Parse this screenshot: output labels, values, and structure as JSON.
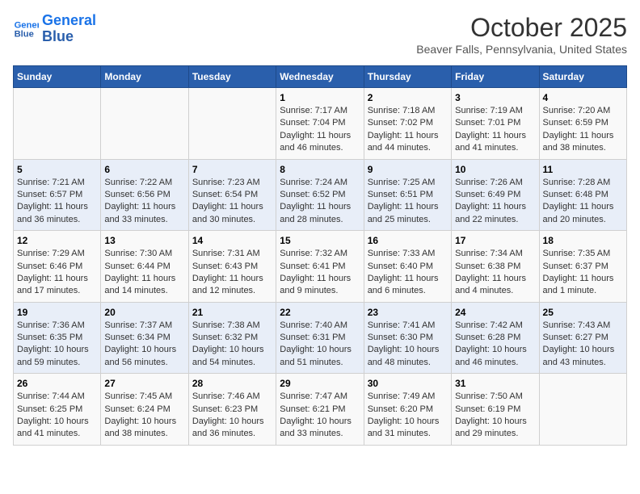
{
  "header": {
    "logo_line1": "General",
    "logo_line2": "Blue",
    "month": "October 2025",
    "location": "Beaver Falls, Pennsylvania, United States"
  },
  "weekdays": [
    "Sunday",
    "Monday",
    "Tuesday",
    "Wednesday",
    "Thursday",
    "Friday",
    "Saturday"
  ],
  "weeks": [
    [
      {
        "day": "",
        "info": ""
      },
      {
        "day": "",
        "info": ""
      },
      {
        "day": "",
        "info": ""
      },
      {
        "day": "1",
        "info": "Sunrise: 7:17 AM\nSunset: 7:04 PM\nDaylight: 11 hours\nand 46 minutes."
      },
      {
        "day": "2",
        "info": "Sunrise: 7:18 AM\nSunset: 7:02 PM\nDaylight: 11 hours\nand 44 minutes."
      },
      {
        "day": "3",
        "info": "Sunrise: 7:19 AM\nSunset: 7:01 PM\nDaylight: 11 hours\nand 41 minutes."
      },
      {
        "day": "4",
        "info": "Sunrise: 7:20 AM\nSunset: 6:59 PM\nDaylight: 11 hours\nand 38 minutes."
      }
    ],
    [
      {
        "day": "5",
        "info": "Sunrise: 7:21 AM\nSunset: 6:57 PM\nDaylight: 11 hours\nand 36 minutes."
      },
      {
        "day": "6",
        "info": "Sunrise: 7:22 AM\nSunset: 6:56 PM\nDaylight: 11 hours\nand 33 minutes."
      },
      {
        "day": "7",
        "info": "Sunrise: 7:23 AM\nSunset: 6:54 PM\nDaylight: 11 hours\nand 30 minutes."
      },
      {
        "day": "8",
        "info": "Sunrise: 7:24 AM\nSunset: 6:52 PM\nDaylight: 11 hours\nand 28 minutes."
      },
      {
        "day": "9",
        "info": "Sunrise: 7:25 AM\nSunset: 6:51 PM\nDaylight: 11 hours\nand 25 minutes."
      },
      {
        "day": "10",
        "info": "Sunrise: 7:26 AM\nSunset: 6:49 PM\nDaylight: 11 hours\nand 22 minutes."
      },
      {
        "day": "11",
        "info": "Sunrise: 7:28 AM\nSunset: 6:48 PM\nDaylight: 11 hours\nand 20 minutes."
      }
    ],
    [
      {
        "day": "12",
        "info": "Sunrise: 7:29 AM\nSunset: 6:46 PM\nDaylight: 11 hours\nand 17 minutes."
      },
      {
        "day": "13",
        "info": "Sunrise: 7:30 AM\nSunset: 6:44 PM\nDaylight: 11 hours\nand 14 minutes."
      },
      {
        "day": "14",
        "info": "Sunrise: 7:31 AM\nSunset: 6:43 PM\nDaylight: 11 hours\nand 12 minutes."
      },
      {
        "day": "15",
        "info": "Sunrise: 7:32 AM\nSunset: 6:41 PM\nDaylight: 11 hours\nand 9 minutes."
      },
      {
        "day": "16",
        "info": "Sunrise: 7:33 AM\nSunset: 6:40 PM\nDaylight: 11 hours\nand 6 minutes."
      },
      {
        "day": "17",
        "info": "Sunrise: 7:34 AM\nSunset: 6:38 PM\nDaylight: 11 hours\nand 4 minutes."
      },
      {
        "day": "18",
        "info": "Sunrise: 7:35 AM\nSunset: 6:37 PM\nDaylight: 11 hours\nand 1 minute."
      }
    ],
    [
      {
        "day": "19",
        "info": "Sunrise: 7:36 AM\nSunset: 6:35 PM\nDaylight: 10 hours\nand 59 minutes."
      },
      {
        "day": "20",
        "info": "Sunrise: 7:37 AM\nSunset: 6:34 PM\nDaylight: 10 hours\nand 56 minutes."
      },
      {
        "day": "21",
        "info": "Sunrise: 7:38 AM\nSunset: 6:32 PM\nDaylight: 10 hours\nand 54 minutes."
      },
      {
        "day": "22",
        "info": "Sunrise: 7:40 AM\nSunset: 6:31 PM\nDaylight: 10 hours\nand 51 minutes."
      },
      {
        "day": "23",
        "info": "Sunrise: 7:41 AM\nSunset: 6:30 PM\nDaylight: 10 hours\nand 48 minutes."
      },
      {
        "day": "24",
        "info": "Sunrise: 7:42 AM\nSunset: 6:28 PM\nDaylight: 10 hours\nand 46 minutes."
      },
      {
        "day": "25",
        "info": "Sunrise: 7:43 AM\nSunset: 6:27 PM\nDaylight: 10 hours\nand 43 minutes."
      }
    ],
    [
      {
        "day": "26",
        "info": "Sunrise: 7:44 AM\nSunset: 6:25 PM\nDaylight: 10 hours\nand 41 minutes."
      },
      {
        "day": "27",
        "info": "Sunrise: 7:45 AM\nSunset: 6:24 PM\nDaylight: 10 hours\nand 38 minutes."
      },
      {
        "day": "28",
        "info": "Sunrise: 7:46 AM\nSunset: 6:23 PM\nDaylight: 10 hours\nand 36 minutes."
      },
      {
        "day": "29",
        "info": "Sunrise: 7:47 AM\nSunset: 6:21 PM\nDaylight: 10 hours\nand 33 minutes."
      },
      {
        "day": "30",
        "info": "Sunrise: 7:49 AM\nSunset: 6:20 PM\nDaylight: 10 hours\nand 31 minutes."
      },
      {
        "day": "31",
        "info": "Sunrise: 7:50 AM\nSunset: 6:19 PM\nDaylight: 10 hours\nand 29 minutes."
      },
      {
        "day": "",
        "info": ""
      }
    ]
  ]
}
